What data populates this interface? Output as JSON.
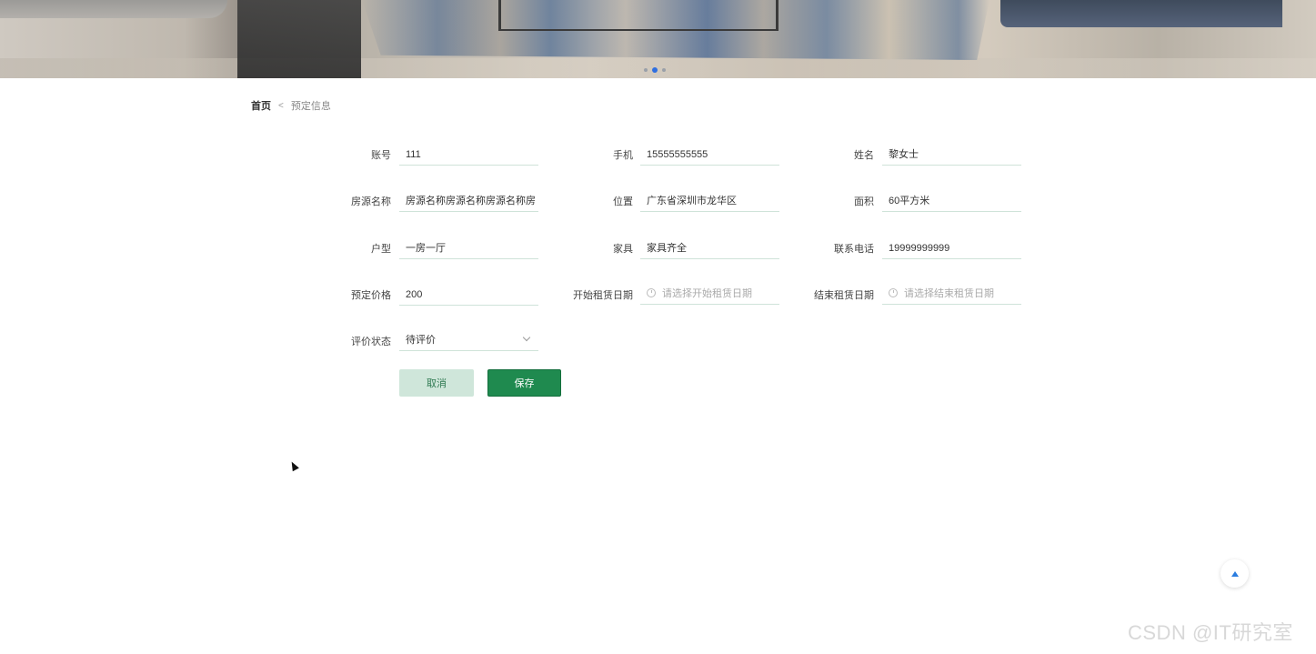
{
  "banner": {
    "carousel": {
      "slide_count": 3,
      "active_index": 1
    }
  },
  "breadcrumb": {
    "home": "首页",
    "separator": "<",
    "current": "预定信息"
  },
  "form": {
    "row1": [
      {
        "label": "账号",
        "value": "111"
      },
      {
        "label": "手机",
        "value": "15555555555"
      },
      {
        "label": "姓名",
        "value": "黎女士"
      }
    ],
    "row2": [
      {
        "label": "房源名称",
        "value": "房源名称房源名称房源名称房"
      },
      {
        "label": "位置",
        "value": "广东省深圳市龙华区"
      },
      {
        "label": "面积",
        "value": "60平方米"
      }
    ],
    "row3": [
      {
        "label": "户型",
        "value": "一房一厅"
      },
      {
        "label": "家具",
        "value": "家具齐全"
      },
      {
        "label": "联系电话",
        "value": "19999999999"
      }
    ],
    "row4": [
      {
        "label": "预定价格",
        "value": "200"
      },
      {
        "label": "开始租赁日期",
        "placeholder": "请选择开始租赁日期"
      },
      {
        "label": "结束租赁日期",
        "placeholder": "请选择结束租赁日期"
      }
    ],
    "row5": [
      {
        "label": "评价状态",
        "value": "待评价"
      }
    ],
    "buttons": {
      "cancel": "取消",
      "save": "保存"
    }
  },
  "watermark": "CSDN @IT研究室",
  "colors": {
    "primary": "#1f8a4f",
    "cancel_bg": "#cfe6da",
    "accent_blue": "#2b7de0"
  }
}
